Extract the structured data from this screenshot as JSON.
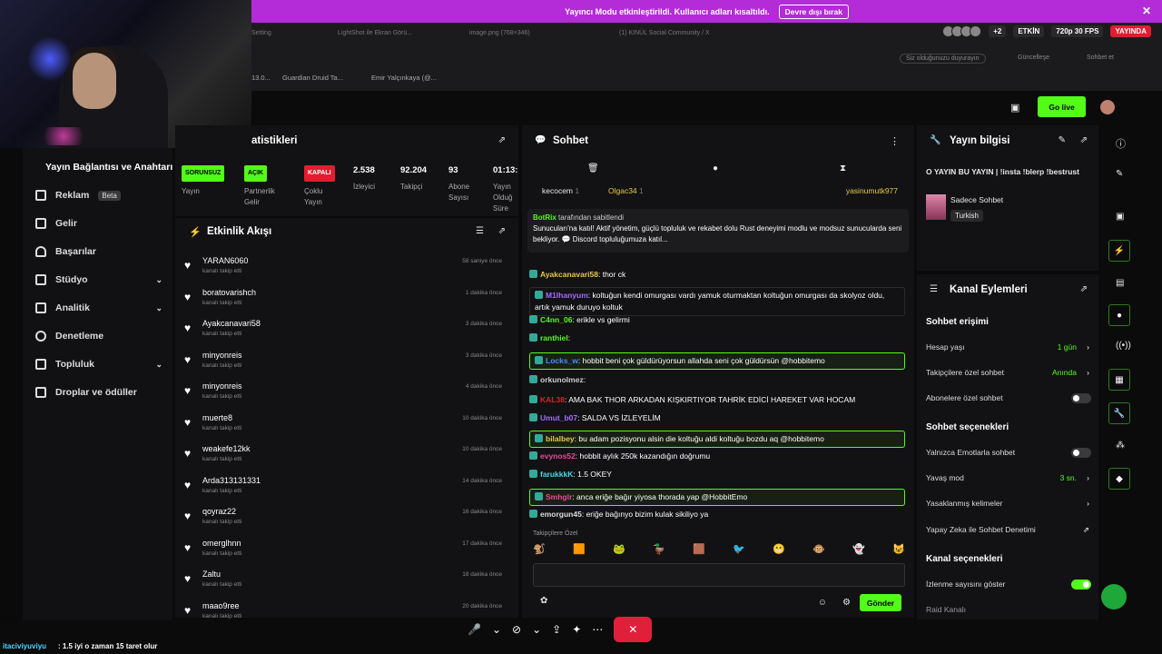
{
  "banner": {
    "text": "Yayıncı Modu etkinleştirildi. Kullanıcı adları kısaltıldı.",
    "button": "Devre dışı bırak"
  },
  "browser": {
    "tabs": [
      "Setting",
      "LightShot ile Ekran Görü...",
      "image.png (768×346)",
      "(1) KINÜL Social Community / X"
    ],
    "status": {
      "count": "+2",
      "active": "ETKİN",
      "quality": "720p 30 FPS",
      "live": "YAYINDA"
    },
    "search_hint": "Siz olduğunuzu duyurayın",
    "update": "Güncelleşe",
    "sohbet": "Sohbet et",
    "bookmarks": [
      "13.0...",
      "Guardian Druid Ta...",
      "Emir Yalçınkaya (@..."
    ]
  },
  "kick": {
    "go_live": "Go live"
  },
  "sidebar": {
    "header": "Yayın Bağlantısı ve Anahtarı",
    "items": [
      {
        "label": "Reklam",
        "badge": "Beta"
      },
      {
        "label": "Gelir"
      },
      {
        "label": "Başarılar"
      },
      {
        "label": "Stüdyo"
      },
      {
        "label": "Analitik"
      },
      {
        "label": "Denetleme"
      },
      {
        "label": "Topluluk"
      },
      {
        "label": "Droplar ve ödüller"
      }
    ]
  },
  "stats": {
    "title": "atistikleri",
    "items": [
      {
        "tag": "SORUNSUZ",
        "label": "Yayın",
        "color": "#53fc18"
      },
      {
        "tag": "AÇIK",
        "label": "Partnerlik Gelir",
        "color": "#53fc18"
      },
      {
        "tag": "KAPALI",
        "label": "Çoklu Yayın",
        "color": "#e01e30"
      },
      {
        "value": "2.538",
        "label": "İzleyici"
      },
      {
        "value": "92.204",
        "label": "Takipçi"
      },
      {
        "value": "93",
        "label": "Abone Sayısı"
      },
      {
        "value": "01:13:",
        "label": "Yayın Olduğ Süre"
      }
    ]
  },
  "activity": {
    "title": "Etkinlik Akışı",
    "sub": "kanalı takip etti",
    "rows": [
      {
        "name": "YARAN6060",
        "time": "58 saniye önce"
      },
      {
        "name": "boratovarishch",
        "time": "1 dakika önce"
      },
      {
        "name": "Ayakcanavari58",
        "time": "3 dakika önce"
      },
      {
        "name": "minyonreis",
        "time": "3 dakika önce"
      },
      {
        "name": "minyonreis",
        "time": "4 dakika önce"
      },
      {
        "name": "muerte8",
        "time": "10 dakika önce"
      },
      {
        "name": "weakefe12kk",
        "time": "10 dakika önce"
      },
      {
        "name": "Arda313131331",
        "time": "14 dakika önce"
      },
      {
        "name": "qoyraz22",
        "time": "16 dakika önce"
      },
      {
        "name": "omerglhnn",
        "time": "17 dakika önce"
      },
      {
        "name": "Zaltu",
        "time": "18 dakika önce"
      },
      {
        "name": "maao9ree",
        "time": "20 dakika önce"
      }
    ]
  },
  "chat": {
    "title": "Sohbet",
    "top_users": [
      "kecocem",
      "Olgac34",
      "yasinumutk977"
    ],
    "top_counts": [
      "1",
      "1"
    ],
    "pinned_by": "BotRix",
    "pinned_by_suffix": "tarafından sabitlendi",
    "pinned": "Sunucuları'na katıl! Aktif yönetim, güçlü topluluk ve rekabet dolu Rust deneyimi modlu ve modsuz sunucularda seni bekliyor. 💬 Discord topluluğumuza katıl...",
    "messages": [
      {
        "user": "Ayakcanavari58",
        "text": "thor ck",
        "color": "#e6c84a",
        "style": ""
      },
      {
        "user": "M1lhanyum",
        "text": "koltuğun kendi omurgası vardı yamuk oturmaktan koltuğun omurgası da skolyoz oldu, artık yamuk duruyo koltuk",
        "color": "#a56bff",
        "style": "gray"
      },
      {
        "user": "C4nn_06",
        "text": "erikle vs gelirmi",
        "color": "#53fc18",
        "style": ""
      },
      {
        "user": "ranthiel",
        "text": "",
        "color": "#53fc18",
        "style": ""
      },
      {
        "user": "Locks_w",
        "text": "hobbit beni çok güldürüyorsun allahda seni çok güldürsün @hobbitemo",
        "color": "#4a8cff",
        "style": "hl"
      },
      {
        "user": "orkunolmez",
        "text": "",
        "color": "#ccc",
        "style": ""
      },
      {
        "user": "KAL38",
        "text": "AMA BAK THOR ARKADAN KIŞKIRTIYOR TAHRİK EDİCİ HAREKET VAR HOCAM",
        "color": "#e02020",
        "style": ""
      },
      {
        "user": "Umut_b07",
        "text": "SALDA VS İZLEYELİM",
        "color": "#a56bff",
        "style": ""
      },
      {
        "user": "bilalbey",
        "text": "bu adam pozisyonu alsin die koltuğu aldi koltuğu bozdu aq @hobbitemo",
        "color": "#e6c84a",
        "style": "hl"
      },
      {
        "user": "evynos52",
        "text": "hobbit aylık 250k kazandığın doğrumu",
        "color": "#e84a9a",
        "style": ""
      },
      {
        "user": "farukkkK",
        "text": "1.5 OKEY",
        "color": "#4ad8e8",
        "style": ""
      },
      {
        "user": "Smhglr",
        "text": "anca eriğe bağır yiyosa thorada yap @HobbitEmo",
        "color": "#e84a9a",
        "style": "hl"
      },
      {
        "user": "emorgun45",
        "text": "eriğe bağınyo bizim kulak sikiliyo ya",
        "color": "#ddd",
        "style": ""
      }
    ],
    "emote_label": "Takipçilere Özel",
    "send": "Gönder"
  },
  "info": {
    "title": "Yayın bilgisi",
    "stream_title": "O YAYIN BU YAYIN | !insta !blerp !bestrust",
    "category": "Sadece Sohbet",
    "lang": "Turkish"
  },
  "actions": {
    "title": "Kanal Eylemleri",
    "chat_access": "Sohbet erişimi",
    "account_age": "Hesap yaşı",
    "account_age_val": "1 gün",
    "followers_only": "Takipçilere özel sohbet",
    "followers_only_val": "Anında",
    "subs_only": "Abonelere özel sohbet",
    "chat_options": "Sohbet seçenekleri",
    "emote_only": "Yalnızca Emotlarla sohbet",
    "slow_mode": "Yavaş mod",
    "slow_mode_val": "3 sn.",
    "banned_words": "Yasaklanmış kelimeler",
    "ai_mod": "Yapay Zeka ile Sohbet Denetimi",
    "channel_options": "Kanal seçenekleri",
    "show_viewers": "İzlenme sayısını göster",
    "raid": "Raid Kanalı"
  },
  "bottom": {
    "ticker_user": "itaciviyuviyu",
    "ticker_text": ": 1.5 iyi o zaman 15 taret olur"
  }
}
